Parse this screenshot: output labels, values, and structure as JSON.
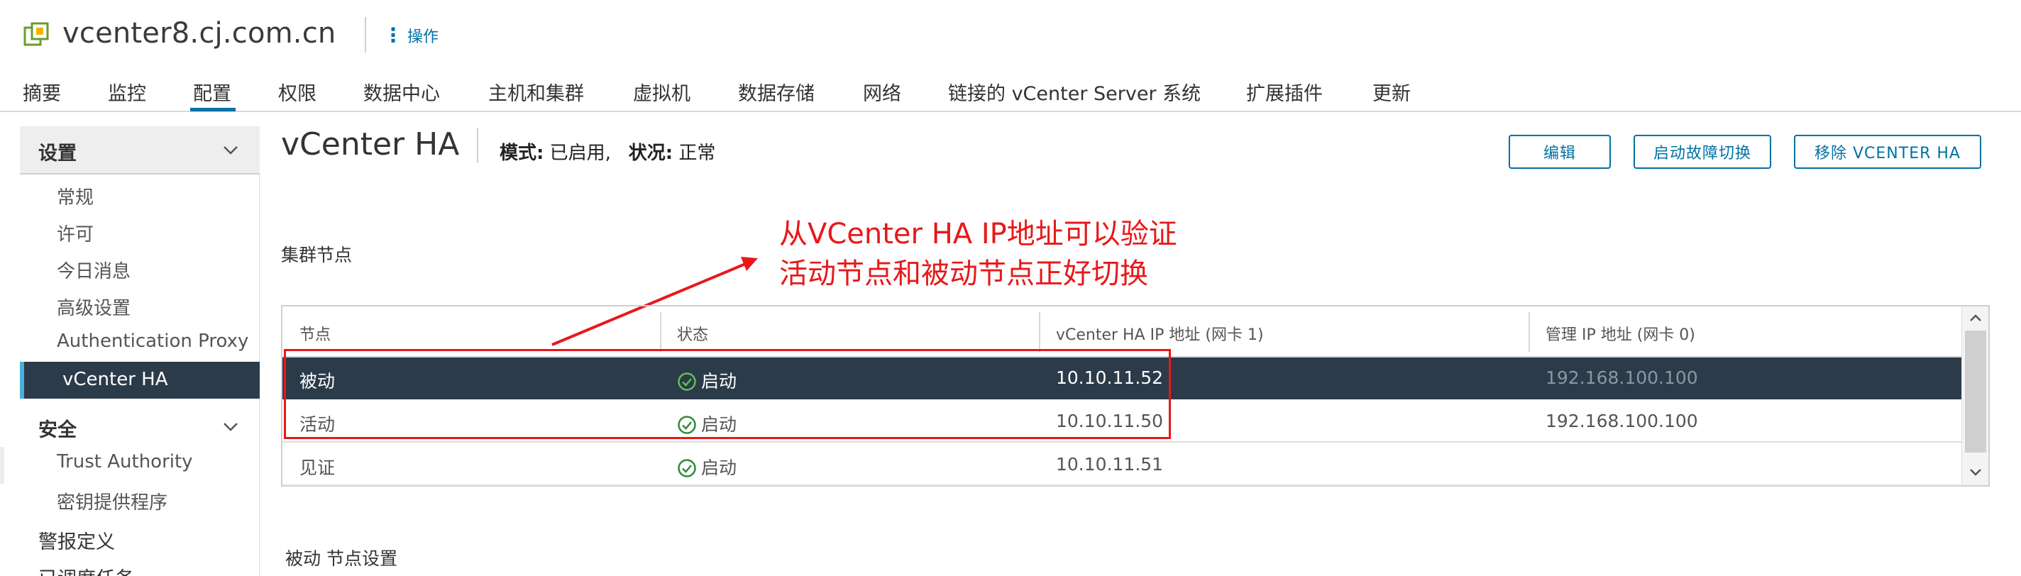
{
  "header": {
    "title": "vcenter8.cj.com.cn",
    "actions_label": "操作"
  },
  "tabs": [
    "摘要",
    "监控",
    "配置",
    "权限",
    "数据中心",
    "主机和集群",
    "虚拟机",
    "数据存储",
    "网络",
    "链接的 vCenter Server 系统",
    "扩展插件",
    "更新"
  ],
  "active_tab": "配置",
  "sidebar": {
    "settings_label": "设置",
    "settings_items": [
      "常规",
      "许可",
      "今日消息",
      "高级设置",
      "Authentication Proxy",
      "vCenter HA"
    ],
    "selected_item": "vCenter HA",
    "security_label": "安全",
    "security_items": [
      "Trust Authority",
      "密钥提供程序"
    ],
    "alarm_label": "警报定义",
    "scheduled_label": "已调度任务"
  },
  "main": {
    "title": "vCenter HA",
    "mode_label": "模式:",
    "mode_value": "已启用,",
    "state_label": "状况:",
    "state_value": "正常",
    "buttons": {
      "edit": "编辑",
      "failover": "启动故障切换",
      "remove": "移除 VCENTER HA"
    },
    "cluster_nodes_label": "集群节点",
    "passive_settings_label": "被动 节点设置"
  },
  "annotation": {
    "line1": "从VCenter HA IP地址可以验证",
    "line2": "活动节点和被动节点正好切换",
    "color": "#e8181a"
  },
  "table": {
    "headers": [
      "节点",
      "状态",
      "vCenter HA IP 地址 (网卡 1)",
      "管理 IP 地址 (网卡 0)"
    ],
    "rows": [
      {
        "node": "被动",
        "status": "启动",
        "ha_ip": "10.10.11.52",
        "mgmt_ip": "192.168.100.100"
      },
      {
        "node": "活动",
        "status": "启动",
        "ha_ip": "10.10.11.50",
        "mgmt_ip": "192.168.100.100"
      },
      {
        "node": "见证",
        "status": "启动",
        "ha_ip": "10.10.11.51",
        "mgmt_ip": ""
      }
    ],
    "selected_row": 0
  },
  "colors": {
    "accent": "#0072a3",
    "selected_bg": "#2b3b4a",
    "ok_green": "#2f8a3a",
    "annotation_red": "#e8181a"
  },
  "icons": {
    "header": "vcenter-icon",
    "menu": "vertical-dots-icon",
    "status": "check-circle-icon",
    "chevron": "chevron-down-icon"
  }
}
